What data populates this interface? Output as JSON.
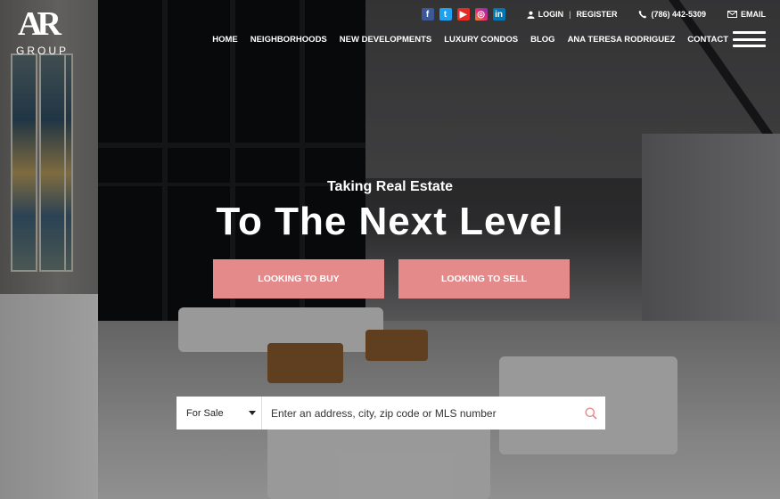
{
  "brand": {
    "mark": "AR",
    "word": "GROUP"
  },
  "topbar": {
    "social": [
      {
        "name": "facebook",
        "glyph": "f"
      },
      {
        "name": "twitter",
        "glyph": "t"
      },
      {
        "name": "youtube",
        "glyph": "▶"
      },
      {
        "name": "instagram",
        "glyph": "◎"
      },
      {
        "name": "linkedin",
        "glyph": "in"
      }
    ],
    "login": "LOGIN",
    "separator": "|",
    "register": "REGISTER",
    "phone": "(786) 442-5309",
    "email": "EMAIL"
  },
  "nav": {
    "items": [
      "HOME",
      "NEIGHBORHOODS",
      "NEW DEVELOPMENTS",
      "LUXURY CONDOS",
      "BLOG",
      "ANA TERESA RODRIGUEZ",
      "CONTACT"
    ]
  },
  "hero": {
    "tagline": "Taking Real Estate",
    "headline": "To The Next Level",
    "buy_label": "LOOKING TO BUY",
    "sell_label": "LOOKING TO SELL"
  },
  "search": {
    "select_value": "For Sale",
    "placeholder": "Enter an address, city, zip code or MLS number"
  },
  "colors": {
    "accent": "#e48a8a",
    "overlay": "#000000"
  },
  "icons": [
    "user-icon",
    "phone-icon",
    "envelope-icon",
    "search-icon",
    "hamburger-icon",
    "caret-down-icon"
  ]
}
